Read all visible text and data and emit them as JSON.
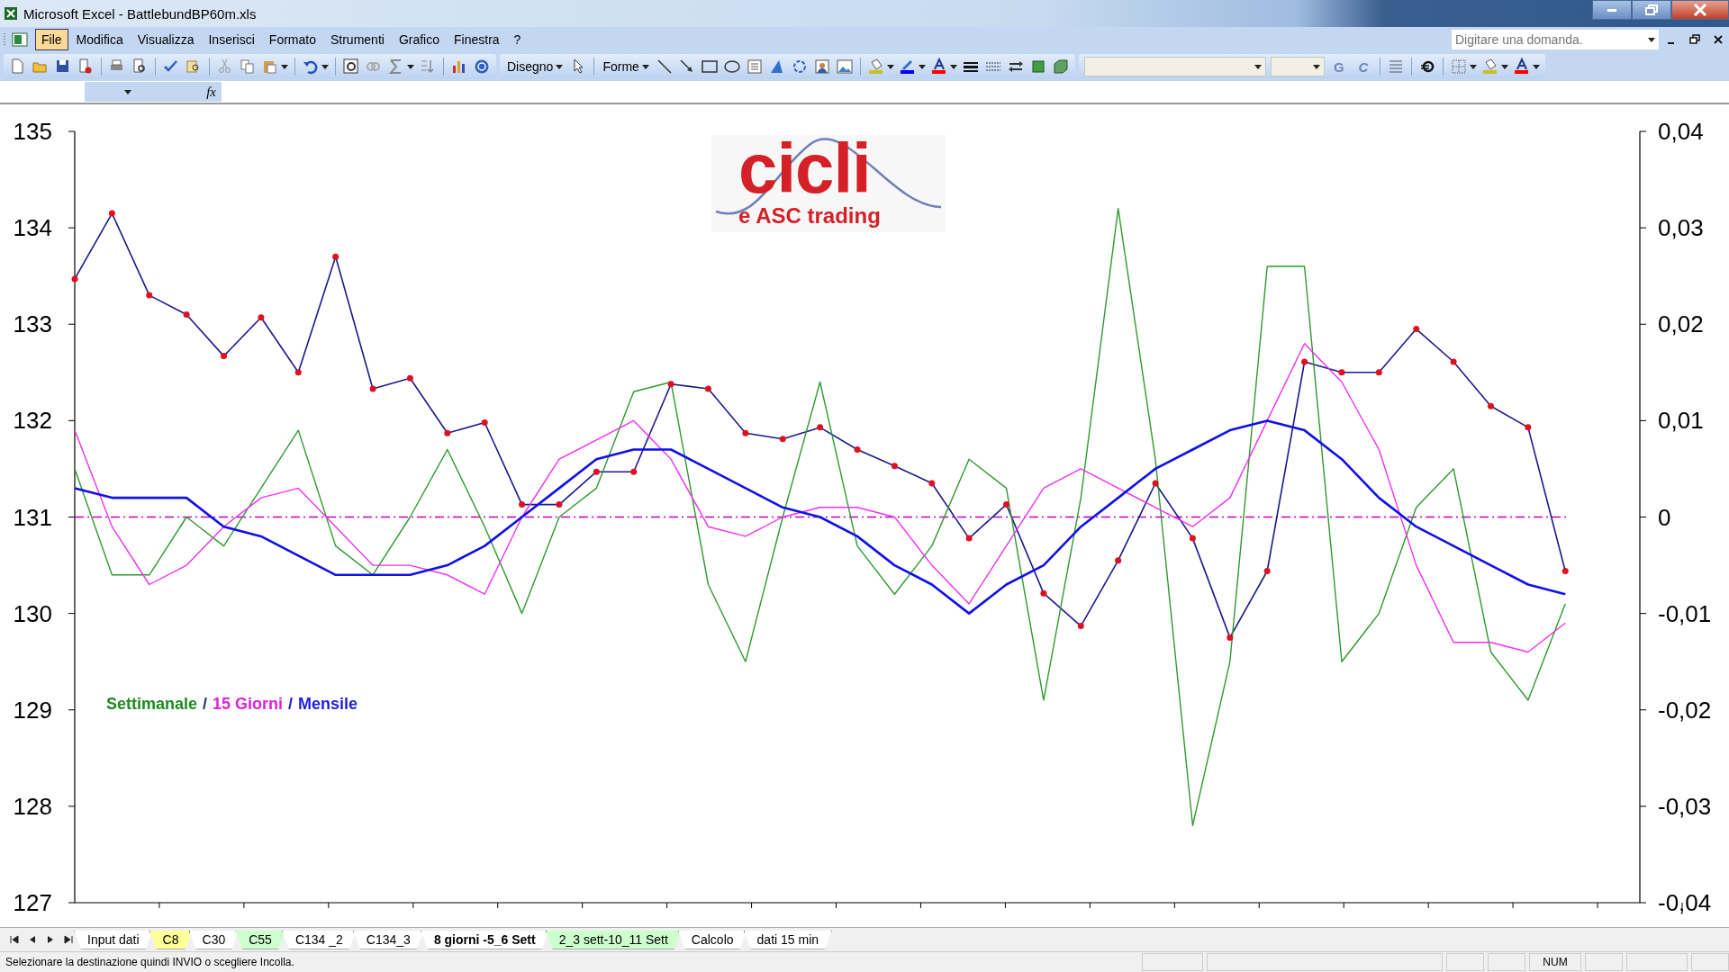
{
  "window": {
    "title": "Microsoft Excel - BattlebundBP60m.xls"
  },
  "menu": [
    {
      "label": "File",
      "selected": true
    },
    {
      "label": "Modifica",
      "selected": false
    },
    {
      "label": "Visualizza",
      "selected": false
    },
    {
      "label": "Inserisci",
      "selected": false
    },
    {
      "label": "Formato",
      "selected": false
    },
    {
      "label": "Strumenti",
      "selected": false
    },
    {
      "label": "Grafico",
      "selected": false
    },
    {
      "label": "Finestra",
      "selected": false
    },
    {
      "label": "?",
      "selected": false
    }
  ],
  "help_box": {
    "placeholder": "Digitare una domanda."
  },
  "drawing_toolbar": {
    "draw_menu": "Disegno",
    "shapes_menu": "Forme"
  },
  "format_toolbar": {
    "bold": "G",
    "italic": "C"
  },
  "formula_bar": {
    "function_label": "fx"
  },
  "chart": {
    "logo": {
      "title": "cicli",
      "subtitle": "e ASC trading"
    },
    "legend": [
      {
        "label": "Settimanale",
        "color": "#1f8a1f"
      },
      {
        "label": "/",
        "color": "#1f3a6a"
      },
      {
        "label": "15 Giorni",
        "color": "#e020e0"
      },
      {
        "label": "/",
        "color": "#2020e0"
      },
      {
        "label": "Mensile",
        "color": "#2020e0"
      }
    ],
    "chart_data": {
      "type": "line",
      "ylim": [
        127,
        135
      ],
      "y2lim": [
        -0.04,
        0.04
      ],
      "yticks": [
        127,
        128,
        129,
        130,
        131,
        132,
        133,
        134,
        135
      ],
      "y2ticks": [
        {
          "value": -0.04,
          "label": "-0,04"
        },
        {
          "value": -0.03,
          "label": "-0,03"
        },
        {
          "value": -0.02,
          "label": "-0,02"
        },
        {
          "value": -0.01,
          "label": "-0,01"
        },
        {
          "value": 0,
          "label": "0"
        },
        {
          "value": 0.01,
          "label": "0,01"
        },
        {
          "value": 0.02,
          "label": "0,02"
        },
        {
          "value": 0.03,
          "label": "0,03"
        },
        {
          "value": 0.04,
          "label": "0,04"
        }
      ],
      "series": [
        {
          "color": "#1a1a8c",
          "marker": "circle",
          "values": [
            133.47,
            134.15,
            133.3,
            133.1,
            132.67,
            133.07,
            132.5,
            133.7,
            132.33,
            132.44,
            131.87,
            131.98,
            131.13,
            131.13,
            131.47,
            131.47,
            132.38,
            132.33,
            131.87,
            131.81,
            131.93,
            131.7,
            131.53,
            131.35,
            130.78,
            131.13,
            130.21,
            129.87,
            130.55,
            131.35,
            130.78,
            129.75,
            130.44,
            132.61,
            132.5,
            132.5,
            132.95,
            132.61,
            132.15,
            131.93,
            130.44
          ]
        },
        {
          "color": "#2e9a2e",
          "axis": "y2",
          "values": [
            0.005,
            -0.006,
            -0.006,
            0,
            -0.003,
            0.003,
            0.009,
            -0.003,
            -0.006,
            0,
            0.007,
            -0.001,
            -0.01,
            0,
            0.003,
            0.013,
            0.014,
            -0.007,
            -0.015,
            0,
            0.014,
            -0.003,
            -0.008,
            -0.003,
            0.006,
            0.003,
            -0.019,
            0.002,
            0.032,
            0.006,
            -0.032,
            -0.015,
            0.026,
            0.026,
            -0.015,
            -0.01,
            0.001,
            0.005,
            -0.014,
            -0.019,
            -0.009
          ]
        },
        {
          "color": "#f030f0",
          "axis": "y2",
          "values": [
            0.009,
            -0.001,
            -0.007,
            -0.005,
            -0.001,
            0.002,
            0.003,
            -0.001,
            -0.005,
            -0.005,
            -0.006,
            -0.008,
            0,
            0.006,
            0.008,
            0.01,
            0.006,
            -0.001,
            -0.002,
            0,
            0.001,
            0.001,
            0,
            -0.005,
            -0.009,
            -0.003,
            0.003,
            0.005,
            0.003,
            0.001,
            -0.001,
            0.002,
            0.01,
            0.018,
            0.014,
            0.007,
            -0.005,
            -0.013,
            -0.013,
            -0.014,
            -0.011
          ]
        },
        {
          "color": "#1010e8",
          "axis": "y2",
          "values": [
            0.003,
            0.002,
            0.002,
            0.002,
            -0.001,
            -0.002,
            -0.004,
            -0.006,
            -0.006,
            -0.006,
            -0.005,
            -0.003,
            0,
            0.003,
            0.006,
            0.007,
            0.007,
            0.005,
            0.003,
            0.001,
            0,
            -0.002,
            -0.005,
            -0.007,
            -0.01,
            -0.007,
            -0.005,
            -0.001,
            0.002,
            0.005,
            0.007,
            0.009,
            0.01,
            0.009,
            0.006,
            0.002,
            -0.001,
            -0.003,
            -0.005,
            -0.007,
            -0.008
          ]
        }
      ],
      "ref_lines": [
        {
          "axis": "y2",
          "value": 0,
          "color": "#c000c0"
        }
      ]
    }
  },
  "sheet_tabs": [
    {
      "label": "Input dati",
      "selected": false,
      "color": "#ffffff"
    },
    {
      "label": "C8",
      "selected": false,
      "color": "#ffff99"
    },
    {
      "label": "C30",
      "selected": false,
      "color": "#ffffff"
    },
    {
      "label": "C55",
      "selected": false,
      "color": "#ccffcc"
    },
    {
      "label": "C134 _2",
      "selected": false,
      "color": "#ffffff"
    },
    {
      "label": "C134_3",
      "selected": false,
      "color": "#ffffff"
    },
    {
      "label": "8 giorni -5_6 Sett",
      "selected": true,
      "color": "#ffffff"
    },
    {
      "label": "2_3 sett-10_11 Sett",
      "selected": false,
      "color": "#ccffcc"
    },
    {
      "label": "Calcolo",
      "selected": false,
      "color": "#ffffff"
    },
    {
      "label": "dati 15 min",
      "selected": false,
      "color": "#ffffff"
    }
  ],
  "status_bar": {
    "message": "Selezionare la destinazione quindi INVIO o scegliere Incolla.",
    "indicator": "NUM"
  }
}
